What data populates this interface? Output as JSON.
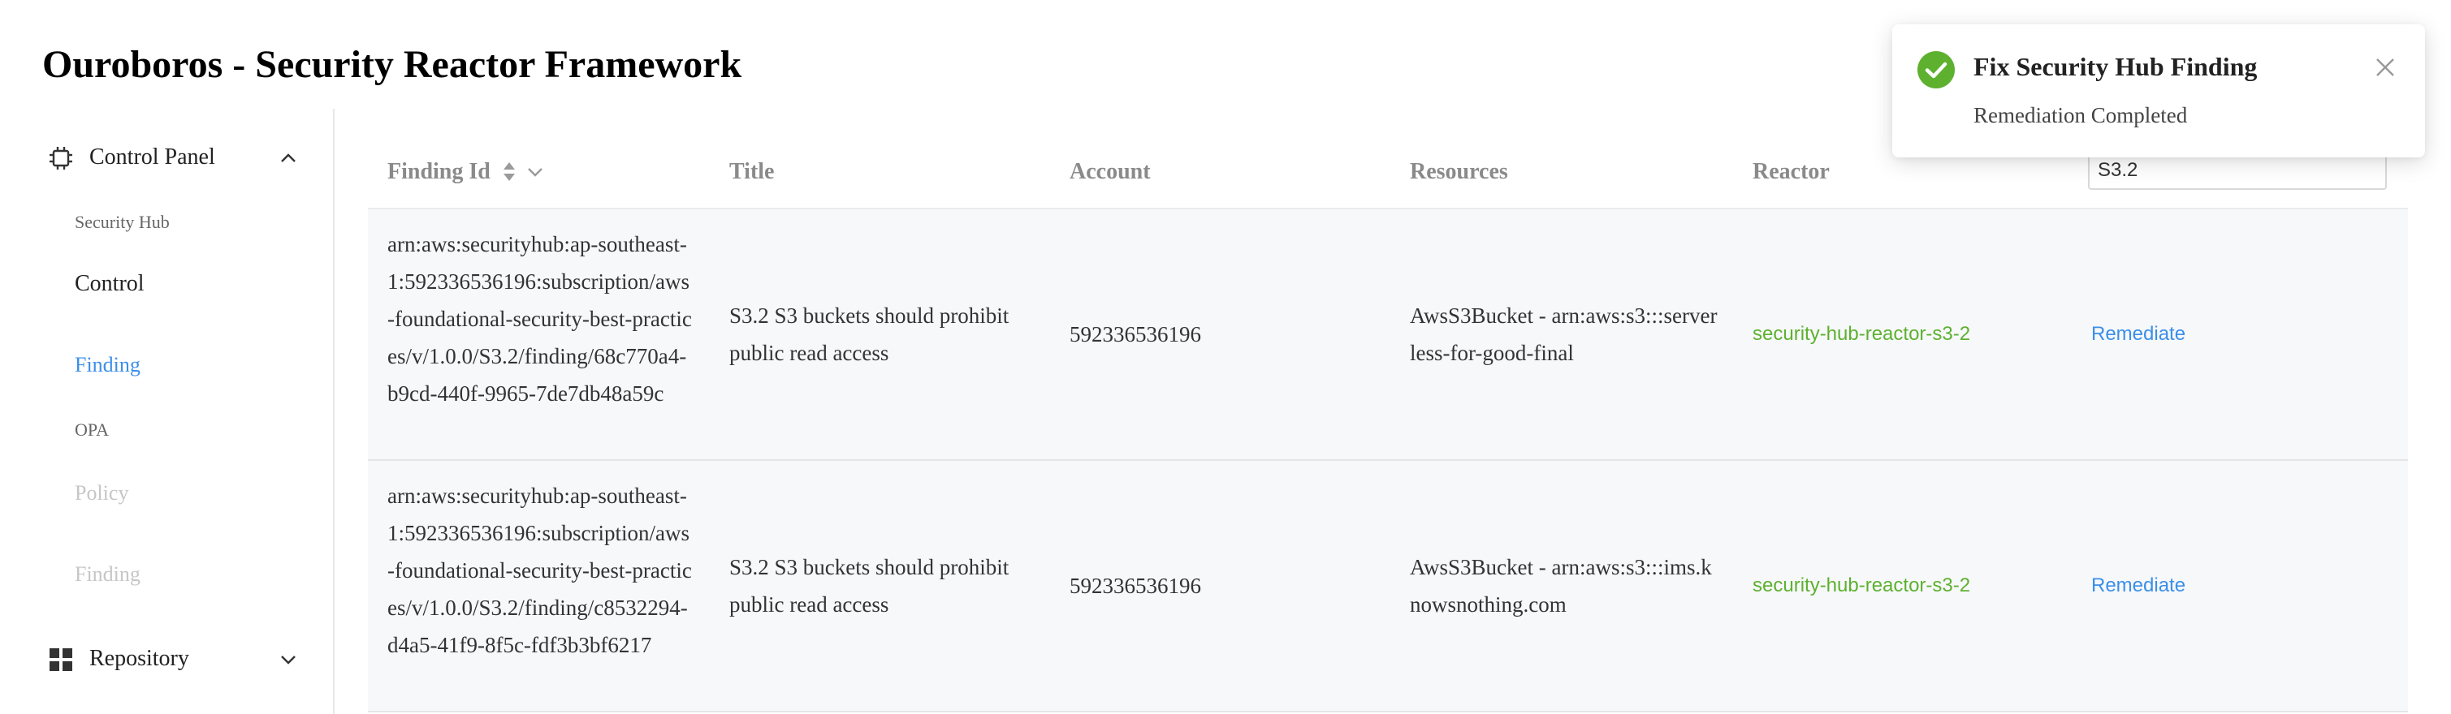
{
  "app": {
    "title": "Ouroboros - Security Reactor Framework"
  },
  "sidebar": {
    "control_panel": {
      "label": "Control Panel",
      "icon": "chip-icon",
      "expanded": true
    },
    "items": [
      {
        "label": "Security Hub",
        "style": "group-header"
      },
      {
        "label": "Control",
        "style": "normal"
      },
      {
        "label": "Finding",
        "style": "active"
      },
      {
        "label": "OPA",
        "style": "group-header"
      },
      {
        "label": "Policy",
        "style": "disabled"
      },
      {
        "label": "Finding",
        "style": "disabled"
      }
    ],
    "repository": {
      "label": "Repository",
      "icon": "grid-icon",
      "expanded": false
    }
  },
  "table": {
    "columns": [
      "Finding Id",
      "Title",
      "Account",
      "Resources",
      "Reactor"
    ],
    "filter": {
      "value": "S3.2"
    },
    "rows": [
      {
        "finding_id": "arn:aws:securityhub:ap-southeast-1:592336536196:subscription/aws-foundational-security-best-practices/v/1.0.0/S3.2/finding/68c770a4-b9cd-440f-9965-7de7db48a59c",
        "title": "S3.2 S3 buckets should prohibit public read access",
        "account": "592336536196",
        "resources": "AwsS3Bucket - arn:aws:s3:::serverless-for-good-final",
        "reactor": "security-hub-reactor-s3-2",
        "action": "Remediate"
      },
      {
        "finding_id": "arn:aws:securityhub:ap-southeast-1:592336536196:subscription/aws-foundational-security-best-practices/v/1.0.0/S3.2/finding/c8532294-d4a5-41f9-8f5c-fdf3b3bf6217",
        "title": "S3.2 S3 buckets should prohibit public read access",
        "account": "592336536196",
        "resources": "AwsS3Bucket - arn:aws:s3:::ims.knowsnothing.com",
        "reactor": "security-hub-reactor-s3-2",
        "action": "Remediate"
      }
    ]
  },
  "toast": {
    "title": "Fix Security Hub Finding",
    "message": "Remediation Completed",
    "icon": "check-circle-icon",
    "close_icon": "close-icon"
  },
  "colors": {
    "accent_blue": "#3b8fe8",
    "success_green": "#5db12f",
    "row_bg": "#f7f8fa",
    "disabled_text": "#c6c6c6"
  }
}
